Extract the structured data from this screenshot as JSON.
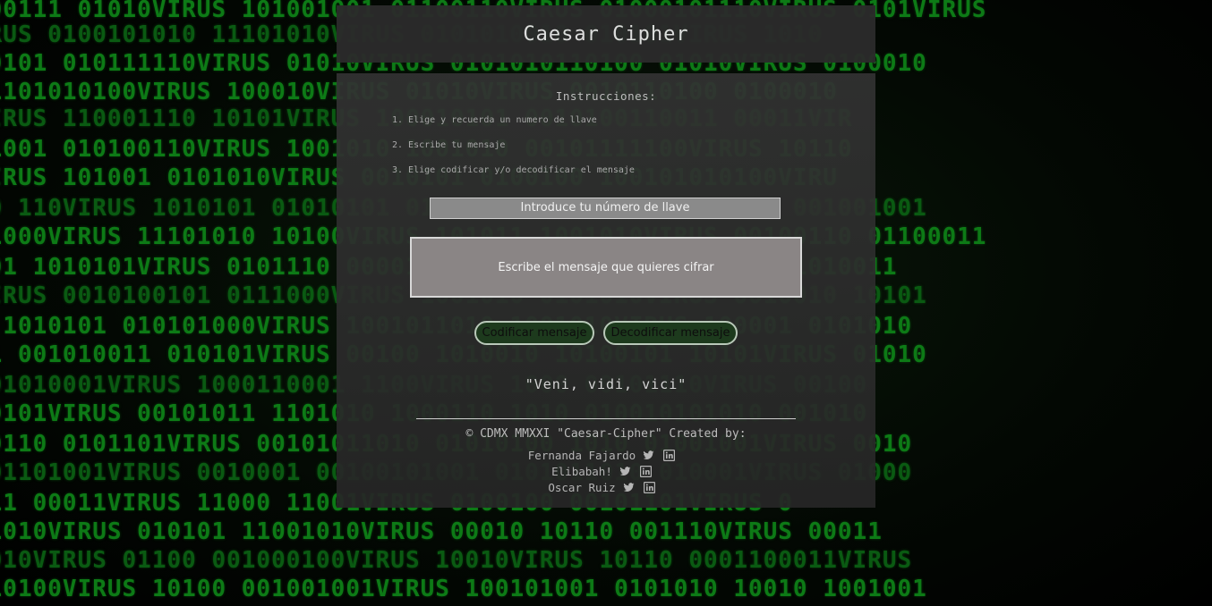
{
  "background": {
    "lines": [
      "000111 01010VIRUS 101001001 01100110VIRUS 01000101110VIRUS 0101VIRUS",
      "IRUS 0100101010 11101010VIRUS 0101010010 010101VIRUS 1010",
      "10101 010111110VIRUS 01010VIRUS 0101010110100 01010VIRUS 0100010",
      "01101010100VIRUS 100010VIRUS 01010VIRUS 0010110100 0100010",
      "VIRUS 110001110 10101VIRUS 100010101 0010100110011 00011VIR",
      "11001 010100110VIRUS 1001010 1001010 00101111100VIRUS 10110",
      "VIRUS 101001 0101010VIRUS 0010101 0100100 100101010100VIRU",
      "00 110VIRUS 1010101 01010101 010100100100 1010101VIRUS 001001001",
      "11000VIRUS 11101010 10100VIRUS 101011 1001010VIRUS 00100110 01100011",
      "001 1010101VIRUS 0101110 00001 10110110 10100VIRUS 10101010011",
      "VIRUS 0010100101 0111000VIRUS 1001010 0101010VIRUS 0010010 10101",
      "S 1010101 010101000VIRUS 1001011010 1001010VIRUS 100001 0101010",
      "01 001010011 010101VIRUS 00100 1010010 10100101 10101VIRUS 01010",
      "101010001VIRUS 1000110001 1100VIRUS 1000 00101110VIRUS 00100",
      "00101VIRUS 00101011 1101010 1000110 1010 010010101010 001010",
      "00110 0101101VIRUS 00101011010 01010100 1010 01001001VIRUS 0010",
      "001101001VIRUS 0010001 00100101001 0101011010 010001VIRUS 01000",
      "111 00011VIRUS 11000 11001VIRUS 0100100 00101101VIRUS 0",
      "01010VIRUS 010101 11001010VIRUS 00010 10110 001110VIRUS 00011",
      "1010VIRUS 01100 001000100VIRUS 10010VIRUS 10110 0001100011VIRUS",
      "010100VIRUS 10100 001001001VIRUS 100101001 0101010 10010 1001001"
    ]
  },
  "header": {
    "title": "Caesar Cipher"
  },
  "instructions": {
    "title": "Instrucciones:",
    "items": [
      "1. Elige y recuerda un numero de llave",
      "2. Escribe tu mensaje",
      "3. Elige codificar y/o decodificar el mensaje"
    ]
  },
  "form": {
    "key_placeholder": "Introduce tu número de llave",
    "message_placeholder": "Escribe el mensaje que quieres cifrar",
    "encode_label": "Codificar mensaje",
    "decode_label": "Decodificar mensaje"
  },
  "quote": "\"Veni, vidi, vici\"",
  "footer": {
    "credits": "© CDMX MMXXI \"Caesar-Cipher\" Created by:",
    "authors": [
      {
        "name": "Fernanda Fajardo",
        "icons": [
          "twitter-icon",
          "linkedin-icon"
        ]
      },
      {
        "name": "Elibabah!",
        "icons": [
          "twitter-icon",
          "linkedin-icon"
        ]
      },
      {
        "name": "Oscar Ruiz",
        "icons": [
          "twitter-icon",
          "linkedin-icon"
        ]
      }
    ]
  },
  "colors": {
    "matrix_green": "#0d7a16",
    "button_bg": "#1d3a1d",
    "card_bg": "#2f2f2f"
  }
}
